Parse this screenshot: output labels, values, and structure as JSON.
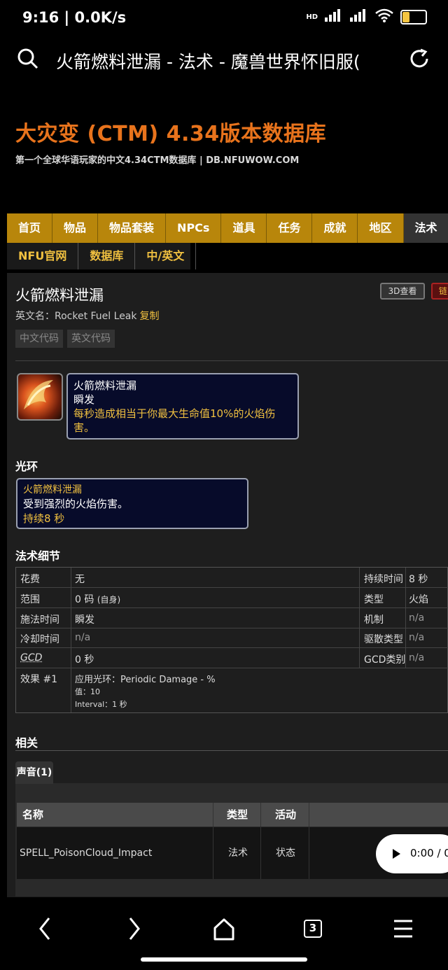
{
  "status_bar": {
    "time": "9:16 | 0.0K/s",
    "network": "HD",
    "battery": "4"
  },
  "address_bar": {
    "title": "火箭燃料泄漏 - 法术 - 魔兽世界怀旧服("
  },
  "banner": {
    "title": "大灾变 (CTM) 4.34版本数据库",
    "subtitle": "第一个全球华语玩家的中文4.34CTM数据库 | DB.NFUWOW.COM"
  },
  "nav_primary": [
    "首页",
    "物品",
    "物品套装",
    "NPCs",
    "道具",
    "任务",
    "成就",
    "地区",
    "法术"
  ],
  "nav_active": "法术",
  "nav_secondary": [
    "NFU官网",
    "数据库",
    "中/英文"
  ],
  "spell": {
    "name": "火箭燃料泄漏",
    "btn_3d": "3D查看",
    "btn_link": "链",
    "english_label": "英文名：Rocket Fuel Leak",
    "copy": "复制",
    "code_cn": "中文代码",
    "code_en": "英文代码"
  },
  "tooltip": {
    "name": "火箭燃料泄漏",
    "cast": "瞬发",
    "desc": "每秒造成相当于你最大生命值10%的火焰伤害。"
  },
  "aura": {
    "heading": "光环",
    "name": "火箭燃料泄漏",
    "desc": "受到强烈的火焰伤害。",
    "duration": "持续8 秒"
  },
  "details": {
    "heading": "法术细节",
    "left": [
      {
        "label": "花费",
        "value": "无"
      },
      {
        "label": "范围",
        "value": "0 码",
        "note": "(自身)"
      },
      {
        "label": "施法时间",
        "value": "瞬发"
      },
      {
        "label": "冷却时间",
        "value": "n/a"
      },
      {
        "label": "GCD",
        "value": "0 秒"
      }
    ],
    "right": [
      {
        "label": "持续时间",
        "value": "8 秒"
      },
      {
        "label": "类型",
        "value": "火焰"
      },
      {
        "label": "机制",
        "value": "n/a"
      },
      {
        "label": "驱散类型",
        "value": "n/a"
      },
      {
        "label": "GCD类别",
        "value": "n/a"
      }
    ],
    "effect": {
      "label": "效果 #1",
      "line1": "应用光环：Periodic Damage - %",
      "line2": "值：10",
      "line3": "Interval：1 秒"
    }
  },
  "related": {
    "heading": "相关",
    "tab": "声音(1)",
    "columns": [
      "名称",
      "类型",
      "活动"
    ],
    "rows": [
      {
        "name": "SPELL_PoisonCloud_Impact",
        "type": "法术",
        "activity": "状态",
        "audio_time": "0:00 / 0:"
      }
    ]
  },
  "bottom_nav": {
    "tabs_count": "3"
  }
}
